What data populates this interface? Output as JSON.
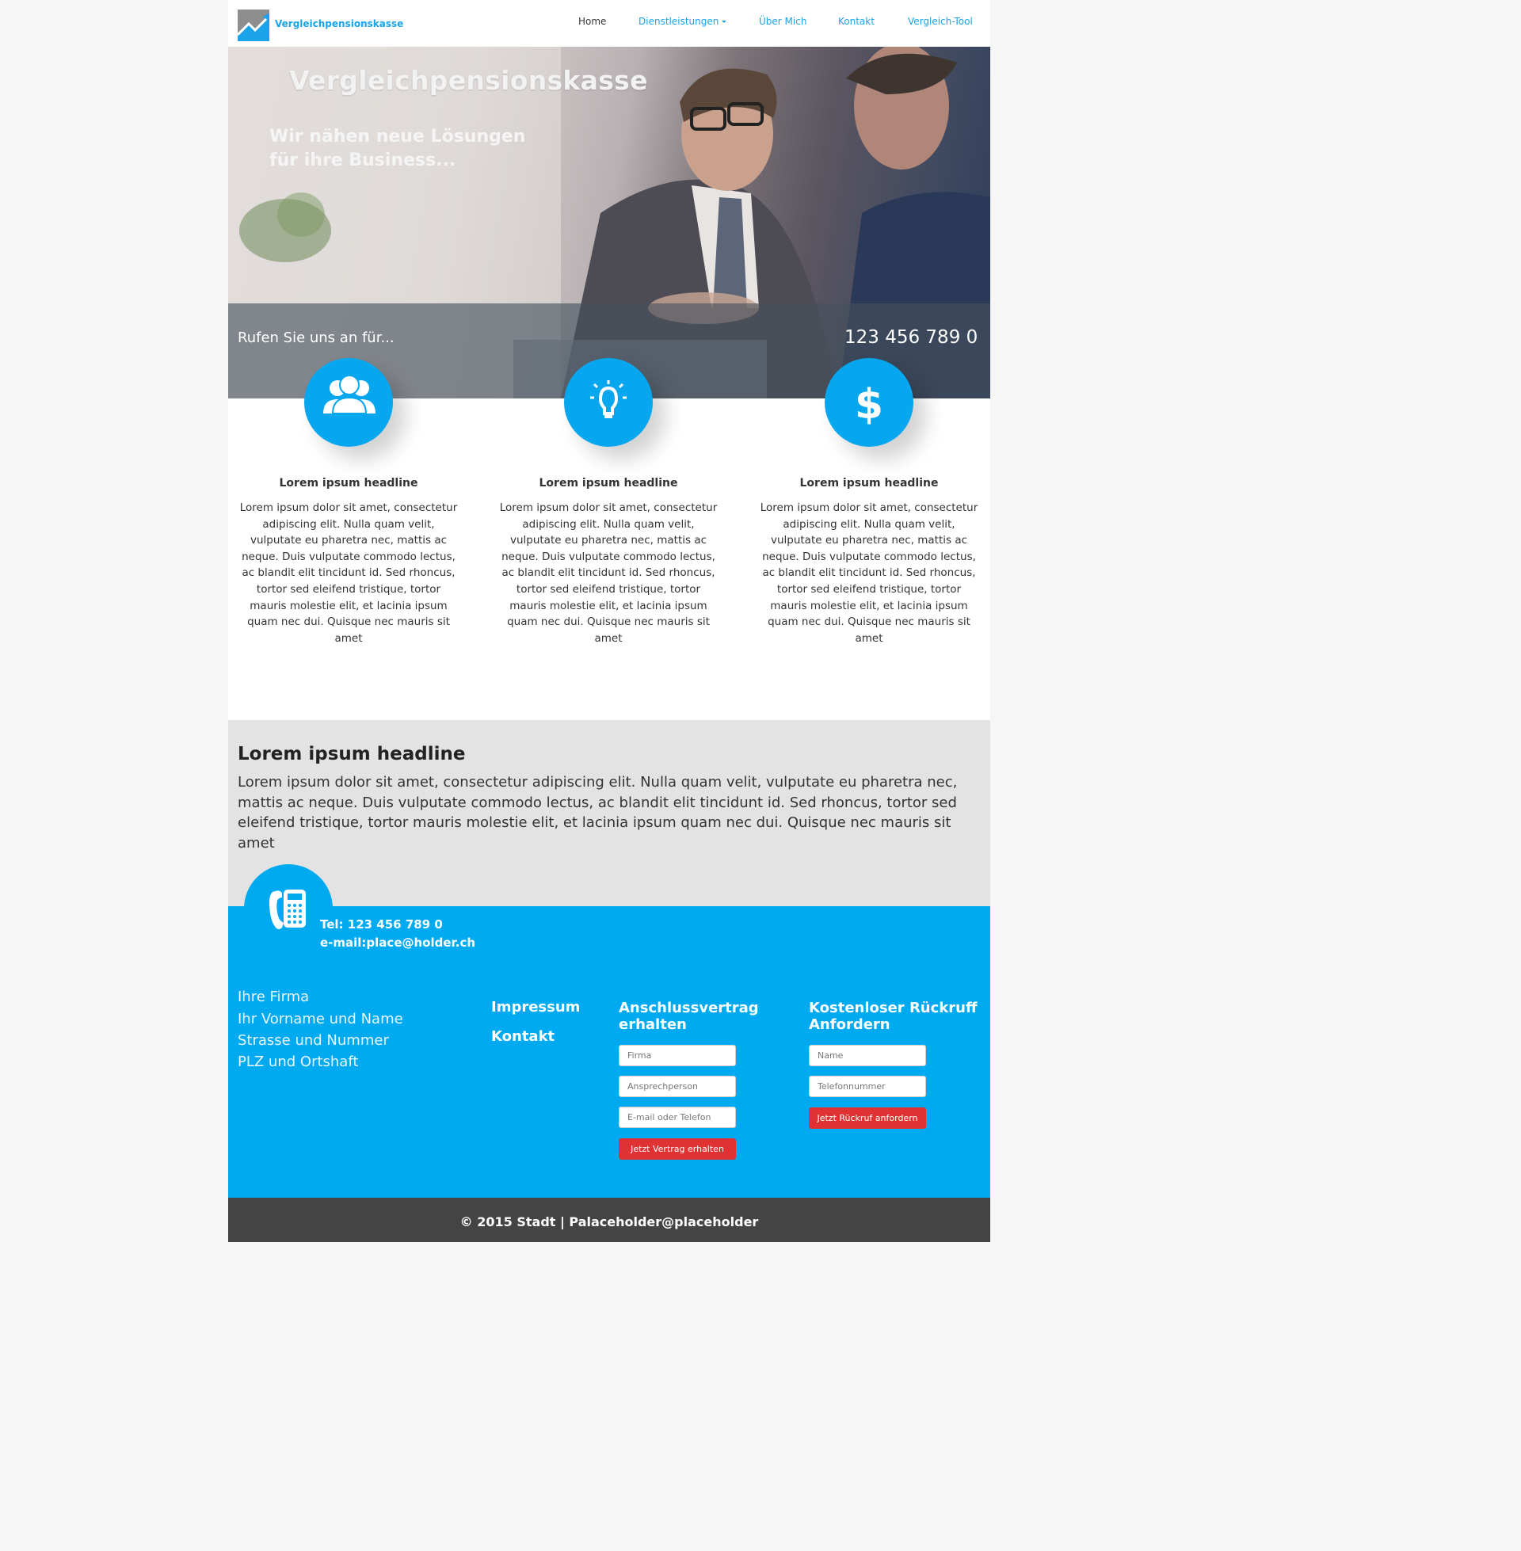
{
  "nav": {
    "brand": "Vergleichpensionskasse",
    "items": [
      {
        "label": "Home",
        "active": true
      },
      {
        "label": "Dienstleistungen",
        "dropdown": true
      },
      {
        "label": "Über Mich"
      },
      {
        "label": "Kontakt"
      },
      {
        "label": "Vergleich-Tool"
      }
    ]
  },
  "hero": {
    "title": "Vergleichpensionskasse",
    "subtitle_line1": "Wir nähen neue Lösungen",
    "subtitle_line2": "für ihre Business...",
    "call_label": "Rufen Sie uns an für...",
    "call_number": "123 456 789 0"
  },
  "features": [
    {
      "icon": "people-icon",
      "headline": "Lorem ipsum headline",
      "text": "Lorem ipsum dolor sit amet, consectetur adipiscing elit. Nulla quam velit, vulputate eu pharetra nec, mattis ac neque. Duis vulputate commodo lectus, ac blandit elit tincidunt id. Sed rhoncus, tortor sed eleifend tristique, tortor mauris molestie elit, et lacinia ipsum quam nec dui. Quisque nec mauris sit amet"
    },
    {
      "icon": "lightbulb-icon",
      "headline": "Lorem ipsum headline",
      "text": "Lorem ipsum dolor sit amet, consectetur adipiscing elit. Nulla quam velit, vulputate eu pharetra nec, mattis ac neque. Duis vulputate commodo lectus, ac blandit elit tincidunt id. Sed rhoncus, tortor sed eleifend tristique, tortor mauris molestie elit, et lacinia ipsum quam nec dui. Quisque nec mauris sit amet"
    },
    {
      "icon": "dollar-icon",
      "headline": "Lorem ipsum headline",
      "text": "Lorem ipsum dolor sit amet, consectetur adipiscing elit. Nulla quam velit, vulputate eu pharetra nec, mattis ac neque. Duis vulputate commodo lectus, ac blandit elit tincidunt id. Sed rhoncus, tortor sed eleifend tristique, tortor mauris molestie elit, et lacinia ipsum quam nec dui. Quisque nec mauris sit amet"
    }
  ],
  "section": {
    "headline": "Lorem ipsum headline",
    "text": "Lorem ipsum dolor sit amet, consectetur adipiscing elit. Nulla quam velit, vulputate eu pharetra nec, mattis ac neque. Duis vulputate commodo lectus, ac blandit elit tincidunt id. Sed rhoncus, tortor sed eleifend tristique, tortor mauris molestie elit, et lacinia ipsum quam nec dui. Quisque nec mauris sit amet"
  },
  "footer": {
    "tel": "Tel: 123 456 789 0",
    "email": "e-mail:place@holder.ch",
    "address": [
      "Ihre Firma",
      "Ihr Vorname und Name",
      "Strasse und Nummer",
      "PLZ und Ortshaft"
    ],
    "links": [
      "Impressum",
      "Kontakt"
    ],
    "form1": {
      "title_line1": "Anschlussvertrag",
      "title_line2": "erhalten",
      "placeholders": [
        "Firma",
        "Ansprechperson",
        "E-mail oder Telefon"
      ],
      "button": "Jetzt Vertrag erhalten"
    },
    "form2": {
      "title_line1": "Kostenloser Rückruff",
      "title_line2": "Anfordern",
      "placeholders": [
        "Name",
        "Telefonnummer"
      ],
      "button": "Jetzt Rückruf anfordern"
    },
    "copyright": "© 2015 Stadt | Palaceholder@placeholder"
  },
  "colors": {
    "accent": "#07a7ef",
    "footer_blue": "#00aaf0",
    "button_red": "#e03232",
    "bottom_bar": "#444444"
  }
}
